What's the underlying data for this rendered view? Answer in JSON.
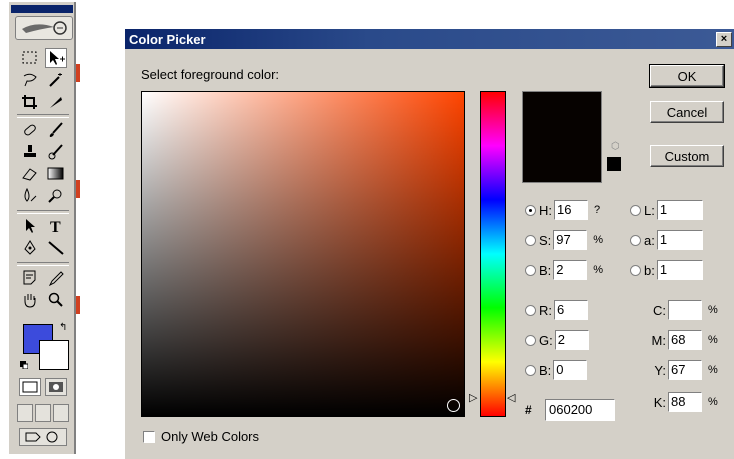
{
  "dialog": {
    "title": "Color Picker",
    "close_label": "×",
    "prompt": "Select foreground color:",
    "buttons": {
      "ok": "OK",
      "cancel": "Cancel",
      "custom": "Custom"
    },
    "hsb": {
      "h": {
        "label": "H:",
        "value": "16",
        "unit": "?"
      },
      "s": {
        "label": "S:",
        "value": "97",
        "unit": "%"
      },
      "b": {
        "label": "B:",
        "value": "2",
        "unit": "%"
      }
    },
    "rgb": {
      "r": {
        "label": "R:",
        "value": "6"
      },
      "g": {
        "label": "G:",
        "value": "2"
      },
      "b": {
        "label": "B:",
        "value": "0"
      }
    },
    "lab": {
      "l": {
        "label": "L:",
        "value": "1"
      },
      "a": {
        "label": "a:",
        "value": "1"
      },
      "b": {
        "label": "b:",
        "value": "1"
      }
    },
    "cmyk": {
      "c": {
        "label": "C:",
        "value": "",
        "unit": "%"
      },
      "m": {
        "label": "M:",
        "value": "68",
        "unit": "%"
      },
      "y": {
        "label": "Y:",
        "value": "67",
        "unit": "%"
      },
      "k": {
        "label": "K:",
        "value": "88",
        "unit": "%"
      }
    },
    "hash": "#",
    "hex": "060200",
    "only_web_colors": "Only Web Colors",
    "current_color": "#060200"
  },
  "toolbar": {
    "foreground_color": "#3c4bdc",
    "background_color": "#ffffff"
  }
}
